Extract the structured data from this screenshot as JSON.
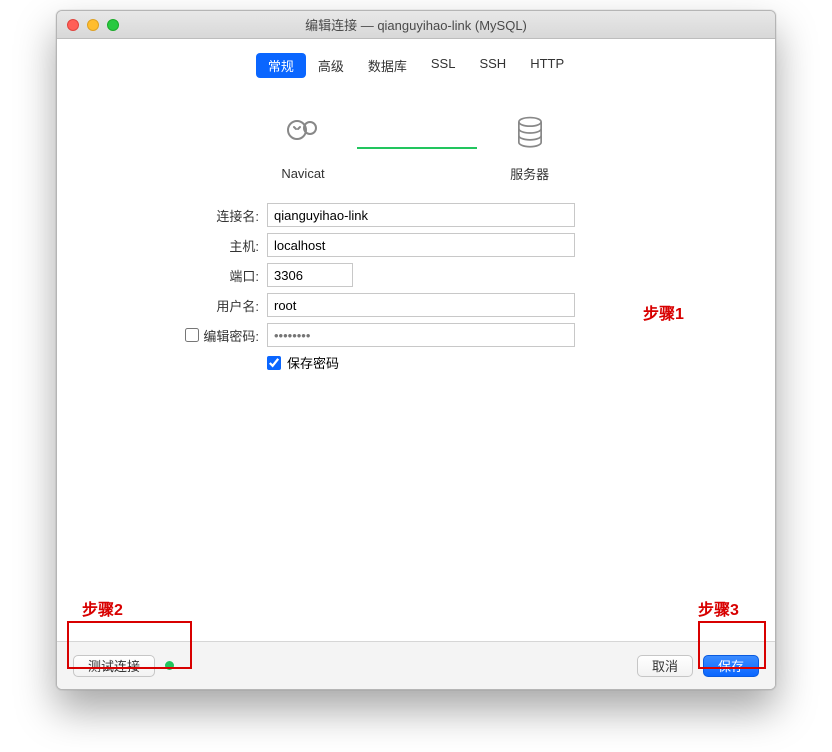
{
  "window": {
    "title": "编辑连接 — qianguyihao-link (MySQL)"
  },
  "tabs": [
    "常规",
    "高级",
    "数据库",
    "SSL",
    "SSH",
    "HTTP"
  ],
  "active_tab_index": 0,
  "diagram": {
    "left_label": "Navicat",
    "right_label": "服务器"
  },
  "form": {
    "labels": {
      "name": "连接名:",
      "host": "主机:",
      "port": "端口:",
      "user": "用户名:",
      "edit_password": "编辑密码:",
      "save_password": "保存密码"
    },
    "values": {
      "name": "qianguyihao-link",
      "host": "localhost",
      "port": "3306",
      "user": "root",
      "password_placeholder": "••••••••"
    },
    "edit_password_checked": false,
    "save_password_checked": true
  },
  "footer": {
    "test_label": "测试连接",
    "cancel_label": "取消",
    "save_label": "保存"
  },
  "annotations": {
    "step1": "步骤1",
    "step2": "步骤2",
    "step3": "步骤3"
  }
}
